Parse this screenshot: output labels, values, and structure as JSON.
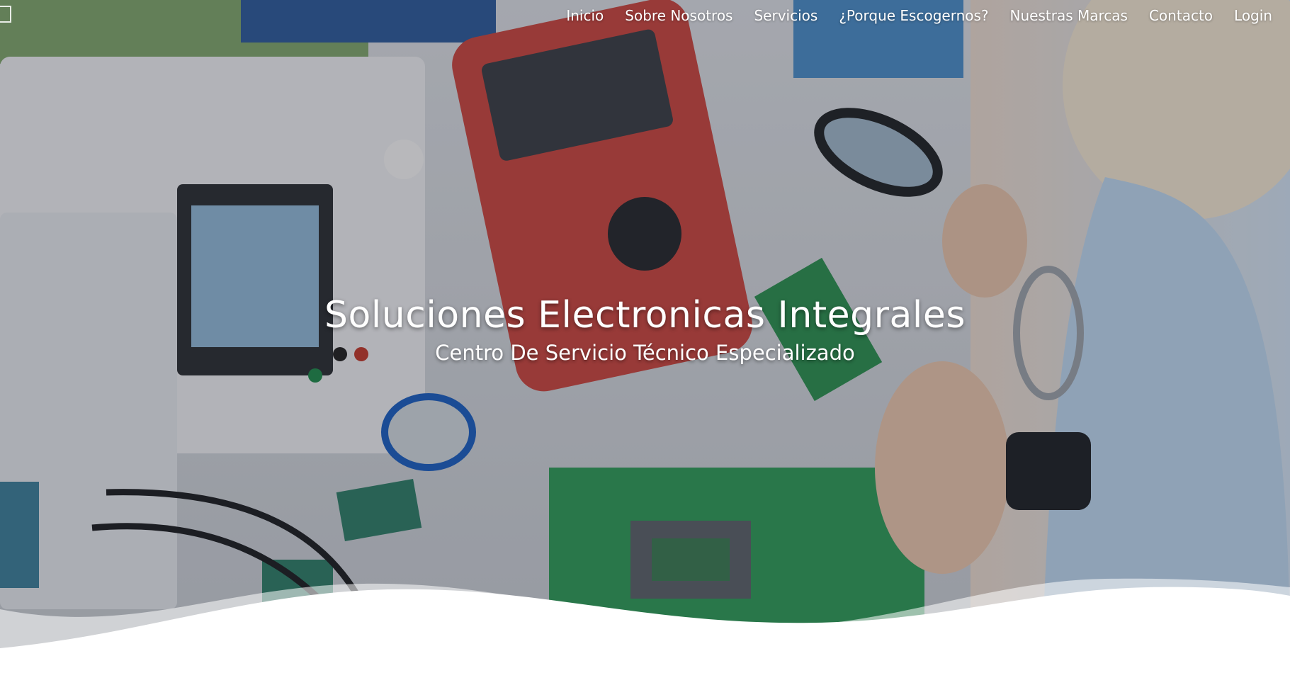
{
  "nav": {
    "items": [
      {
        "label": "Inicio"
      },
      {
        "label": "Sobre Nosotros"
      },
      {
        "label": "Servicios"
      },
      {
        "label": "¿Porque Escogernos?"
      },
      {
        "label": "Nuestras Marcas"
      },
      {
        "label": "Contacto"
      },
      {
        "label": "Login"
      }
    ]
  },
  "hero": {
    "title": "Soluciones Electronicas Integrales",
    "subtitle": "Centro De Servicio Técnico Especializado",
    "background_image": "electronics repair lab: technician soldering circuit board with magnifier, multimeter and power supply",
    "overlay_color": "#1e1e28"
  },
  "colors": {
    "nav_text": "#ffffff",
    "hero_text": "#ffffff",
    "wave_fill": "#ffffff"
  }
}
